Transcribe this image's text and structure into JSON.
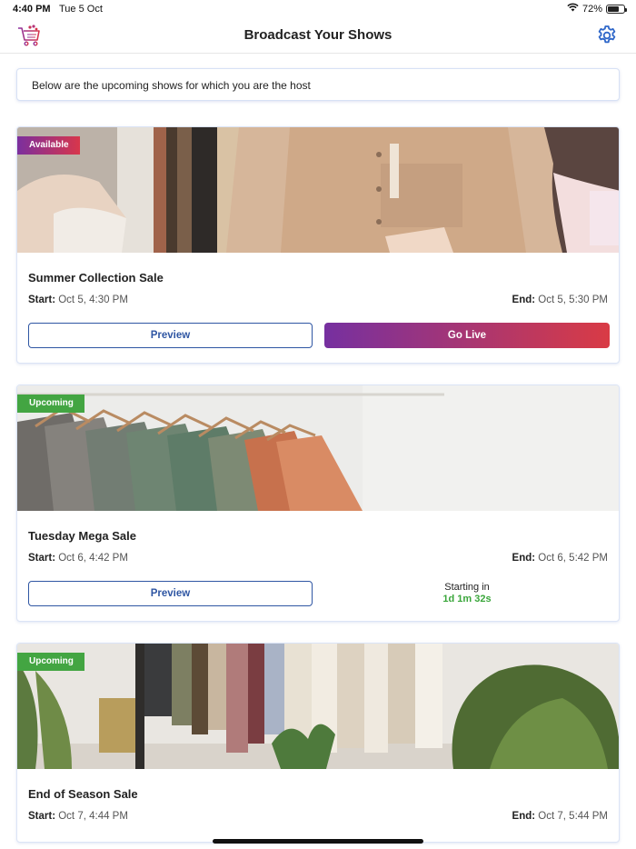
{
  "status_bar": {
    "time": "4:40 PM",
    "date": "Tue 5 Oct",
    "battery": "72%",
    "battery_level": 0.72
  },
  "header": {
    "title": "Broadcast Your Shows",
    "left_icon": "shopping-cart-icon",
    "right_icon": "gear-icon"
  },
  "info_text": "Below are the upcoming shows for which you are the host",
  "shows": [
    {
      "badge": "Available",
      "title": "Summer Collection Sale",
      "start_label": "Start:",
      "start": "Oct 5, 4:30 PM",
      "end_label": "End:",
      "end": "Oct 5, 5:30 PM",
      "preview_label": "Preview",
      "go_live_label": "Go Live"
    },
    {
      "badge": "Upcoming",
      "title": "Tuesday Mega Sale",
      "start_label": "Start:",
      "start": "Oct 6, 4:42 PM",
      "end_label": "End:",
      "end": "Oct 6, 5:42 PM",
      "preview_label": "Preview",
      "countdown_label": "Starting in",
      "countdown_value": "1d 1m 32s"
    },
    {
      "badge": "Upcoming",
      "title": "End of Season Sale",
      "start_label": "Start:",
      "start": "Oct 7, 4:44 PM",
      "end_label": "End:",
      "end": "Oct 7, 5:44 PM"
    }
  ],
  "colors": {
    "accent_blue": "#2f56a3",
    "gradient_start": "#7630a0",
    "gradient_end": "#d93b45",
    "upcoming_green": "#43a542"
  }
}
